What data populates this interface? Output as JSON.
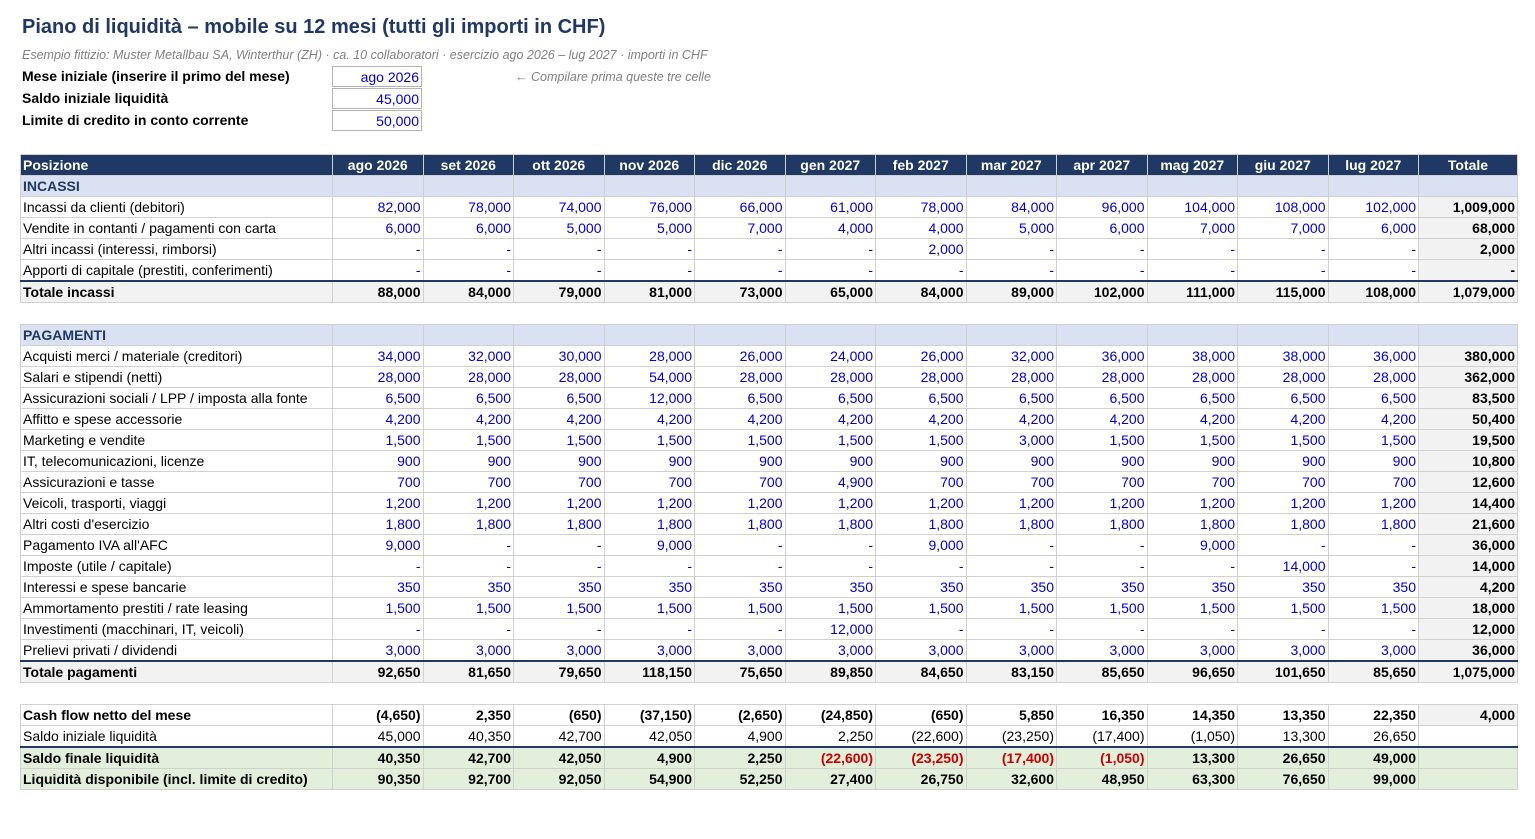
{
  "title": "Piano di liquidità – mobile su 12 mesi (tutti gli importi in CHF)",
  "subtitle": "Esempio fittizio: Muster Metallbau SA, Winterthur (ZH) · ca. 10 collaboratori · esercizio ago 2026 – lug 2027 · importi in CHF",
  "params": {
    "start_month_label": "Mese iniziale (inserire il primo del mese)",
    "start_month_value": "ago 2026",
    "opening_balance_label": "Saldo iniziale liquidità",
    "opening_balance_value": "45,000",
    "credit_limit_label": "Limite di credito in conto corrente",
    "credit_limit_value": "50,000",
    "hint": "← Compilare prima queste tre celle"
  },
  "header": {
    "position": "Posizione",
    "months": [
      "ago 2026",
      "set 2026",
      "ott 2026",
      "nov 2026",
      "dic 2026",
      "gen 2027",
      "feb 2027",
      "mar 2027",
      "apr 2027",
      "mag 2027",
      "giu 2027",
      "lug 2027"
    ],
    "total": "Totale"
  },
  "receipts": {
    "section": "INCASSI",
    "rows": [
      {
        "label": "Incassi da clienti (debitori)",
        "values": [
          "82,000",
          "78,000",
          "74,000",
          "76,000",
          "66,000",
          "61,000",
          "78,000",
          "84,000",
          "96,000",
          "104,000",
          "108,000",
          "102,000"
        ],
        "total": "1,009,000"
      },
      {
        "label": "Vendite in contanti / pagamenti con carta",
        "values": [
          "6,000",
          "6,000",
          "5,000",
          "5,000",
          "7,000",
          "4,000",
          "4,000",
          "5,000",
          "6,000",
          "7,000",
          "7,000",
          "6,000"
        ],
        "total": "68,000"
      },
      {
        "label": "Altri incassi (interessi, rimborsi)",
        "values": [
          "-",
          "-",
          "-",
          "-",
          "-",
          "-",
          "2,000",
          "-",
          "-",
          "-",
          "-",
          "-"
        ],
        "total": "2,000"
      },
      {
        "label": "Apporti di capitale (prestiti, conferimenti)",
        "values": [
          "-",
          "-",
          "-",
          "-",
          "-",
          "-",
          "-",
          "-",
          "-",
          "-",
          "-",
          "-"
        ],
        "total": "-"
      }
    ],
    "total_label": "Totale incassi",
    "total_values": [
      "88,000",
      "84,000",
      "79,000",
      "81,000",
      "73,000",
      "65,000",
      "84,000",
      "89,000",
      "102,000",
      "111,000",
      "115,000",
      "108,000"
    ],
    "total_total": "1,079,000"
  },
  "payments": {
    "section": "PAGAMENTI",
    "rows": [
      {
        "label": "Acquisti merci / materiale (creditori)",
        "values": [
          "34,000",
          "32,000",
          "30,000",
          "28,000",
          "26,000",
          "24,000",
          "26,000",
          "32,000",
          "36,000",
          "38,000",
          "38,000",
          "36,000"
        ],
        "total": "380,000"
      },
      {
        "label": "Salari e stipendi (netti)",
        "values": [
          "28,000",
          "28,000",
          "28,000",
          "54,000",
          "28,000",
          "28,000",
          "28,000",
          "28,000",
          "28,000",
          "28,000",
          "28,000",
          "28,000"
        ],
        "total": "362,000"
      },
      {
        "label": "Assicurazioni sociali / LPP / imposta alla fonte",
        "values": [
          "6,500",
          "6,500",
          "6,500",
          "12,000",
          "6,500",
          "6,500",
          "6,500",
          "6,500",
          "6,500",
          "6,500",
          "6,500",
          "6,500"
        ],
        "total": "83,500"
      },
      {
        "label": "Affitto e spese accessorie",
        "values": [
          "4,200",
          "4,200",
          "4,200",
          "4,200",
          "4,200",
          "4,200",
          "4,200",
          "4,200",
          "4,200",
          "4,200",
          "4,200",
          "4,200"
        ],
        "total": "50,400"
      },
      {
        "label": "Marketing e vendite",
        "values": [
          "1,500",
          "1,500",
          "1,500",
          "1,500",
          "1,500",
          "1,500",
          "1,500",
          "3,000",
          "1,500",
          "1,500",
          "1,500",
          "1,500"
        ],
        "total": "19,500"
      },
      {
        "label": "IT, telecomunicazioni, licenze",
        "values": [
          "900",
          "900",
          "900",
          "900",
          "900",
          "900",
          "900",
          "900",
          "900",
          "900",
          "900",
          "900"
        ],
        "total": "10,800"
      },
      {
        "label": "Assicurazioni e tasse",
        "values": [
          "700",
          "700",
          "700",
          "700",
          "700",
          "4,900",
          "700",
          "700",
          "700",
          "700",
          "700",
          "700"
        ],
        "total": "12,600"
      },
      {
        "label": "Veicoli, trasporti, viaggi",
        "values": [
          "1,200",
          "1,200",
          "1,200",
          "1,200",
          "1,200",
          "1,200",
          "1,200",
          "1,200",
          "1,200",
          "1,200",
          "1,200",
          "1,200"
        ],
        "total": "14,400"
      },
      {
        "label": "Altri costi d'esercizio",
        "values": [
          "1,800",
          "1,800",
          "1,800",
          "1,800",
          "1,800",
          "1,800",
          "1,800",
          "1,800",
          "1,800",
          "1,800",
          "1,800",
          "1,800"
        ],
        "total": "21,600"
      },
      {
        "label": "Pagamento IVA all'AFC",
        "values": [
          "9,000",
          "-",
          "-",
          "9,000",
          "-",
          "-",
          "9,000",
          "-",
          "-",
          "9,000",
          "-",
          "-"
        ],
        "total": "36,000"
      },
      {
        "label": "Imposte (utile / capitale)",
        "values": [
          "-",
          "-",
          "-",
          "-",
          "-",
          "-",
          "-",
          "-",
          "-",
          "-",
          "14,000",
          "-"
        ],
        "total": "14,000"
      },
      {
        "label": "Interessi e spese bancarie",
        "values": [
          "350",
          "350",
          "350",
          "350",
          "350",
          "350",
          "350",
          "350",
          "350",
          "350",
          "350",
          "350"
        ],
        "total": "4,200"
      },
      {
        "label": "Ammortamento prestiti / rate leasing",
        "values": [
          "1,500",
          "1,500",
          "1,500",
          "1,500",
          "1,500",
          "1,500",
          "1,500",
          "1,500",
          "1,500",
          "1,500",
          "1,500",
          "1,500"
        ],
        "total": "18,000"
      },
      {
        "label": "Investimenti (macchinari, IT, veicoli)",
        "values": [
          "-",
          "-",
          "-",
          "-",
          "-",
          "12,000",
          "-",
          "-",
          "-",
          "-",
          "-",
          "-"
        ],
        "total": "12,000"
      },
      {
        "label": "Prelievi privati / dividendi",
        "values": [
          "3,000",
          "3,000",
          "3,000",
          "3,000",
          "3,000",
          "3,000",
          "3,000",
          "3,000",
          "3,000",
          "3,000",
          "3,000",
          "3,000"
        ],
        "total": "36,000"
      }
    ],
    "total_label": "Totale pagamenti",
    "total_values": [
      "92,650",
      "81,650",
      "79,650",
      "118,150",
      "75,650",
      "89,850",
      "84,650",
      "83,150",
      "85,650",
      "96,650",
      "101,650",
      "85,650"
    ],
    "total_total": "1,075,000"
  },
  "summary": {
    "net_label": "Cash flow netto del mese",
    "net_values": [
      "(4,650)",
      "2,350",
      "(650)",
      "(37,150)",
      "(2,650)",
      "(24,850)",
      "(650)",
      "5,850",
      "16,350",
      "14,350",
      "13,350",
      "22,350"
    ],
    "net_total": "4,000",
    "opening_label": "Saldo iniziale liquidità",
    "opening_values": [
      "45,000",
      "40,350",
      "42,700",
      "42,050",
      "4,900",
      "2,250",
      "(22,600)",
      "(23,250)",
      "(17,400)",
      "(1,050)",
      "13,300",
      "26,650"
    ],
    "closing_label": "Saldo finale liquidità",
    "closing_values": [
      "40,350",
      "42,700",
      "42,050",
      "4,900",
      "2,250",
      "(22,600)",
      "(23,250)",
      "(17,400)",
      "(1,050)",
      "13,300",
      "26,650",
      "49,000"
    ],
    "available_label": "Liquidità disponibile (incl. limite di credito)",
    "available_values": [
      "90,350",
      "92,700",
      "92,050",
      "54,900",
      "52,250",
      "27,400",
      "26,750",
      "32,600",
      "48,950",
      "63,300",
      "76,650",
      "99,000"
    ]
  },
  "colors": {
    "header_bg": "#1f3864",
    "section_bg": "#d9e1f2",
    "input_blue": "#0000cc",
    "negative_red": "#cc0000",
    "balance_bg": "#e2efda"
  }
}
